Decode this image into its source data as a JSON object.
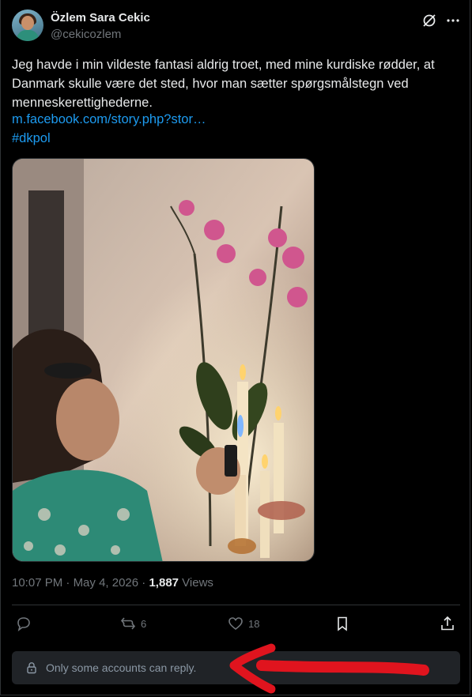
{
  "author": {
    "name": "Özlem Sara Cekic",
    "handle": "@cekicozlem"
  },
  "tweet": {
    "text": "Jeg havde i min vildeste fantasi aldrig troet, med mine kurdiske rødder, at Danmark skulle være det sted, hvor man sætter spørgsmålstegn ved menneskerettighederne.",
    "link": "m.facebook.com/story.php?stor…",
    "hashtag": "#dkpol"
  },
  "meta": {
    "time": "10:07 PM",
    "separator1": " · ",
    "date": "May 4, 2026",
    "separator2": " · ",
    "views_count": "1,887",
    "views_label": " Views"
  },
  "actions": {
    "reply_count": "",
    "retweet_count": "6",
    "like_count": "18",
    "bookmark_count": "",
    "share_count": ""
  },
  "reply_restriction": "Only some accounts can reply.",
  "icons": [
    "grok-icon",
    "more-icon",
    "reply-icon",
    "retweet-icon",
    "like-icon",
    "bookmark-icon",
    "share-icon",
    "lock-icon"
  ],
  "colors": {
    "background": "#000000",
    "text": "#e7e9ea",
    "muted": "#71767b",
    "link": "#1d9bf0",
    "annotation_red": "#e0141e"
  }
}
